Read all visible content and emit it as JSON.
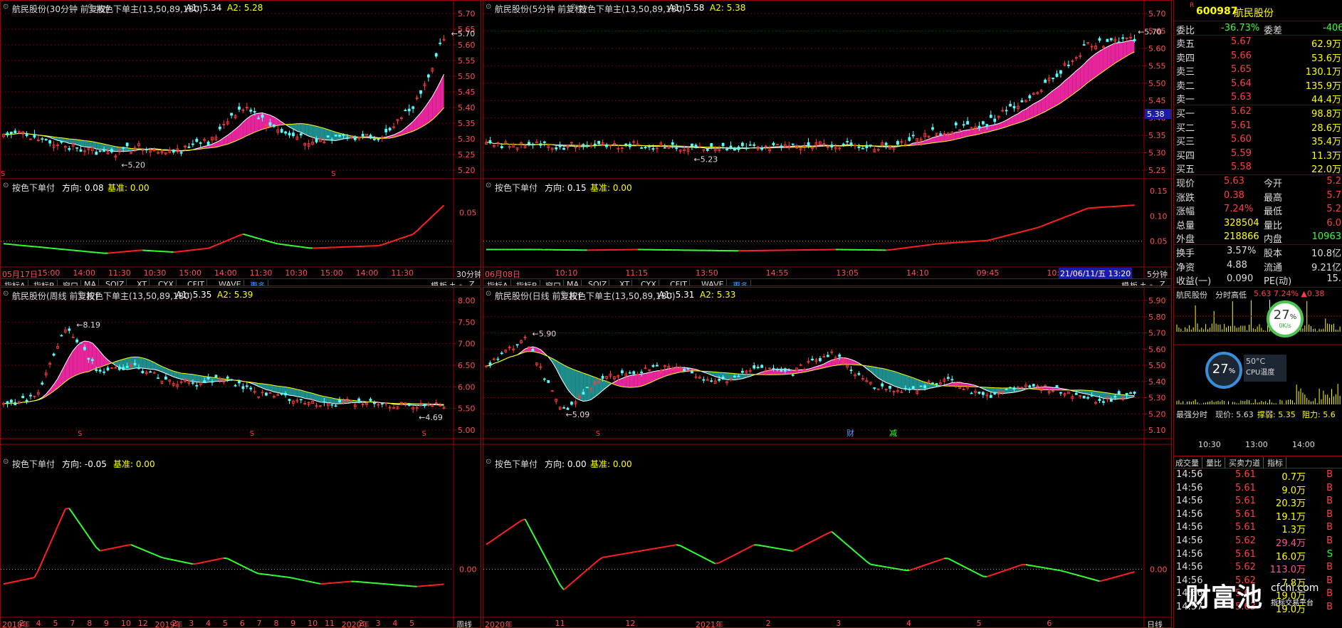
{
  "colors": {
    "up": "#ff3c3c",
    "down": "#54ffff",
    "ma1": "#ffff00",
    "ma2": "#ffffff",
    "fillA": "#e6249b",
    "fillB": "#1f8c8c",
    "grid": "#7a0000",
    "osc_up": "#ff2020",
    "osc_dn": "#33ff33"
  },
  "panels": [
    {
      "title": "航民股份(30分钟 前复权)",
      "ind": "按色下单主(13,50,89,180)",
      "a1": "A1: 5.34",
      "a2": "A2: 5.28",
      "yticks": [
        "5.70",
        "5.65",
        "5.60",
        "5.55",
        "5.50",
        "5.45",
        "5.40",
        "5.35",
        "5.30",
        "5.25",
        "5.20"
      ],
      "high": "5.70",
      "low": "5.20",
      "sub_title": "按色下单付",
      "sub_dir": "方向: 0.08",
      "sub_base": "基准: 0.00",
      "sub_ticks": [
        "0.05"
      ],
      "xlabels": [
        "05月17日",
        "15:00",
        "14:00",
        "11:30",
        "10:30",
        "15:00",
        "14:00",
        "11:30",
        "10:30",
        "15:00",
        "14:00",
        "11:30"
      ],
      "period": "30分钟",
      "sigs": [
        "S",
        "S"
      ]
    },
    {
      "title": "航民股份(5分钟 前复权)",
      "ind": "按色下单主(13,50,89,180)",
      "a1": "A1: 5.58",
      "a2": "A2: 5.38",
      "yticks": [
        "5.70",
        "5.65",
        "5.60",
        "5.55",
        "5.50",
        "5.45",
        "5.40",
        "5.35",
        "5.30",
        "5.25"
      ],
      "high": "5.70",
      "low": "5.23",
      "price_mark": "5.38",
      "sub_title": "按色下单付",
      "sub_dir": "方向: 0.15",
      "sub_base": "基准: 0.00",
      "sub_ticks": [
        "0.15",
        "0.10",
        "0.05"
      ],
      "xlabels": [
        "06月08日",
        "10:10",
        "11:15",
        "13:50",
        "14:55",
        "13:05",
        "14:10",
        "09:45",
        "10:50"
      ],
      "xhighlight": "21/06/11/五 13:20",
      "period": "5分钟"
    },
    {
      "title": "航民股份(周线 前复权)",
      "ind": "按色下单主(13,50,89,180)",
      "a1": "A1: 5.35",
      "a2": "A2: 5.39",
      "yticks": [
        "8.00",
        "7.50",
        "7.00",
        "6.50",
        "6.00",
        "5.50",
        "5.00"
      ],
      "high": "8.19",
      "low": "4.69",
      "sub_title": "按色下单付",
      "sub_dir": "方向: -0.05",
      "sub_base": "基准: 0.00",
      "sub_ticks": [
        "0.00"
      ],
      "xlabels": [
        "2018年",
        "2",
        "4",
        "5",
        "7",
        "8",
        "9",
        "10",
        "12",
        "2019年",
        "2",
        "3",
        "4",
        "5",
        "6",
        "7",
        "8",
        "9",
        "10",
        "11",
        "2020年",
        "2",
        "3",
        "4",
        "5"
      ],
      "period": "周线",
      "sigs": [
        "S",
        "S",
        "S"
      ]
    },
    {
      "title": "航民股份(日线 前复权)",
      "ind": "按色下单主(13,50,89,180)",
      "a1": "A1: 5.31",
      "a2": "A2: 5.33",
      "yticks": [
        "5.90",
        "5.80",
        "5.70",
        "5.60",
        "5.50",
        "5.40",
        "5.30",
        "5.20",
        "5.10"
      ],
      "high": "5.90",
      "low": "5.09",
      "sub_title": "按色下单付",
      "sub_dir": "方向: 0.00",
      "sub_base": "基准: 0.00",
      "sub_ticks": [
        "0.00"
      ],
      "xlabels": [
        "2020年",
        "11",
        "12",
        "2021年",
        "2",
        "3",
        "4",
        "5",
        "6"
      ],
      "period": "日线",
      "sigs": [
        "S"
      ],
      "tags": [
        "财",
        "减"
      ]
    }
  ],
  "toolbar": [
    "指标A",
    "指标B",
    "窗口",
    "MA",
    "SQJZ",
    "XT",
    "CYX",
    "CFJT",
    "WAVE",
    "更多"
  ],
  "toolbar_right": [
    "模",
    "板",
    "+",
    "-",
    "Z"
  ],
  "quote": {
    "badge": "R",
    "code": "600987",
    "name": "航民股份",
    "ratio_label": "委比",
    "ratio": "-36.73%",
    "diff_label": "委差",
    "diff": "-406",
    "sell": [
      {
        "l": "卖五",
        "p": "5.67",
        "v": "62.9万"
      },
      {
        "l": "卖四",
        "p": "5.66",
        "v": "53.6万"
      },
      {
        "l": "卖三",
        "p": "5.65",
        "v": "130.1万"
      },
      {
        "l": "卖二",
        "p": "5.64",
        "v": "135.9万"
      },
      {
        "l": "卖一",
        "p": "5.63",
        "v": "44.4万"
      }
    ],
    "buy": [
      {
        "l": "买一",
        "p": "5.62",
        "v": "98.8万"
      },
      {
        "l": "买二",
        "p": "5.61",
        "v": "28.6万"
      },
      {
        "l": "买三",
        "p": "5.60",
        "v": "35.4万"
      },
      {
        "l": "买四",
        "p": "5.59",
        "v": "11.3万"
      },
      {
        "l": "买五",
        "p": "5.58",
        "v": "22.0万"
      }
    ],
    "stats": [
      {
        "l": "现价",
        "v": "5.63",
        "l2": "今开",
        "v2": "5.2"
      },
      {
        "l": "涨跌",
        "v": "0.38",
        "l2": "最高",
        "v2": "5.7"
      },
      {
        "l": "涨幅",
        "v": "7.24%",
        "l2": "最低",
        "v2": "5.2"
      },
      {
        "l": "总量",
        "v": "328504",
        "l2": "量比",
        "v2": "6.0"
      },
      {
        "l": "外盘",
        "v": "218866",
        "l2": "内盘",
        "v2": "10963"
      }
    ],
    "stats2": [
      {
        "l": "换手",
        "v": "3.57%",
        "l2": "股本",
        "v2": "10.8亿"
      },
      {
        "l": "净资",
        "v": "4.88",
        "l2": "流通",
        "v2": "9.21亿"
      },
      {
        "l": "收益(一)",
        "v": "0.090",
        "l2": "PE(动)",
        "v2": "15."
      }
    ],
    "mini_title": "航民股份",
    "mini_label": "分时高低",
    "mini_vals": "5.63 7.24% ▲0.38",
    "mini_t": [
      "10:30",
      "13:00",
      "14:00"
    ],
    "strong_title": "最强分时",
    "strong_price": "现价: 5.63",
    "strong_sup": "撑弱: 5.35",
    "strong_res": "阻力: 5.6",
    "tabs": [
      "成交量",
      "量比",
      "买卖力道",
      "指标"
    ],
    "trades": [
      {
        "t": "14:56",
        "p": "5.61",
        "v": "0.7万",
        "s": "B"
      },
      {
        "t": "14:56",
        "p": "5.61",
        "v": "9.0万",
        "s": "B"
      },
      {
        "t": "14:56",
        "p": "5.61",
        "v": "20.3万",
        "s": "B"
      },
      {
        "t": "14:56",
        "p": "5.61",
        "v": "19.1万",
        "s": "B"
      },
      {
        "t": "14:56",
        "p": "5.61",
        "v": "1.3万",
        "s": "B"
      },
      {
        "t": "14:56",
        "p": "5.62",
        "v": "29.4万",
        "s": "B"
      },
      {
        "t": "14:56",
        "p": "5.61",
        "v": "16.0万",
        "s": "S"
      },
      {
        "t": "14:56",
        "p": "5.62",
        "v": "113.0万",
        "s": "B"
      },
      {
        "t": "14:56",
        "p": "5.62",
        "v": "7.8万",
        "s": "B"
      },
      {
        "t": "14:56",
        "p": "5.63",
        "v": "19.0万",
        "s": "B"
      },
      {
        "t": "14:57",
        "p": "5.63",
        "v": "19.0万",
        "s": "B"
      }
    ],
    "cpu1": "27",
    "cpu1_sub": "0K/s",
    "cpu2": "27",
    "temp": "50°C",
    "temp_label": "CPU温度",
    "wm_cn": "财富池",
    "wm_url": "cfchi.com",
    "wm_sub": "指标交易平台"
  }
}
